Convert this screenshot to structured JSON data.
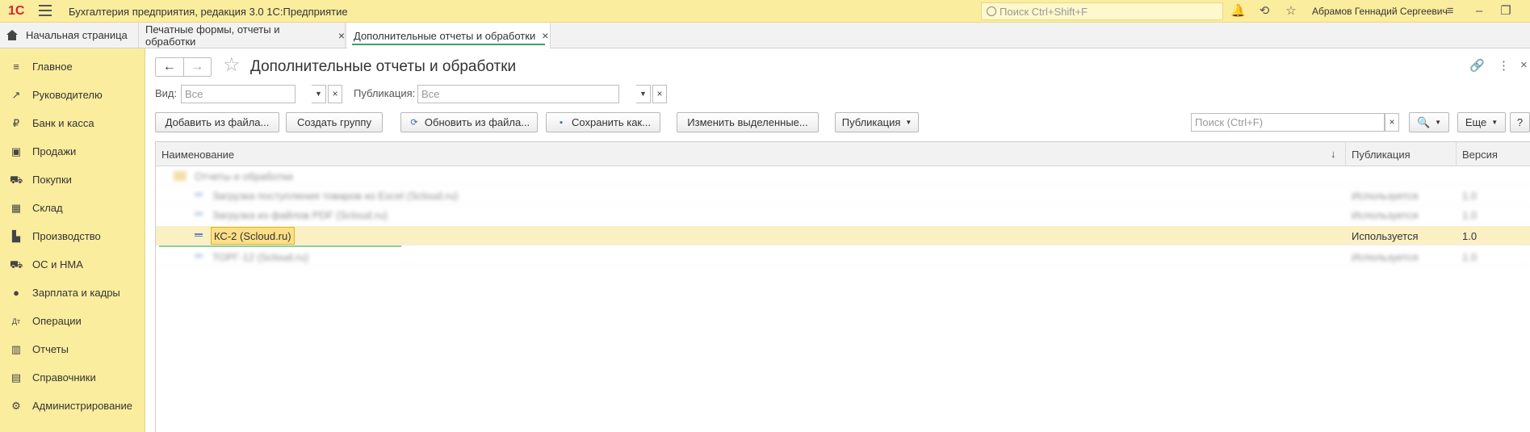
{
  "app": {
    "logo": "1С",
    "title": "Бухгалтерия предприятия, редакция 3.0 1С:Предприятие",
    "search_placeholder": "Поиск Ctrl+Shift+F",
    "user": "Абрамов Геннадий Сергеевич"
  },
  "tabs": {
    "home": "Начальная страница",
    "items": [
      {
        "label": "Печатные формы, отчеты и обработки",
        "close": "×"
      },
      {
        "label": "Дополнительные отчеты и обработки",
        "close": "×"
      }
    ]
  },
  "sidebar": {
    "items": [
      {
        "label": "Главное",
        "icon": "≡"
      },
      {
        "label": "Руководителю",
        "icon": "↗"
      },
      {
        "label": "Банк и касса",
        "icon": "₽"
      },
      {
        "label": "Продажи",
        "icon": "▣"
      },
      {
        "label": "Покупки",
        "icon": "⛟"
      },
      {
        "label": "Склад",
        "icon": "▦"
      },
      {
        "label": "Производство",
        "icon": "▙"
      },
      {
        "label": "ОС и НМА",
        "icon": "⛟"
      },
      {
        "label": "Зарплата и кадры",
        "icon": "●"
      },
      {
        "label": "Операции",
        "icon": "Дт"
      },
      {
        "label": "Отчеты",
        "icon": "▥"
      },
      {
        "label": "Справочники",
        "icon": "▤"
      },
      {
        "label": "Администрирование",
        "icon": "⚙"
      }
    ]
  },
  "form": {
    "title": "Дополнительные отчеты и обработки",
    "back": "←",
    "forward": "→",
    "star": "☆",
    "link_icon": "🔗",
    "more_icon": "⋮",
    "close_icon": "×",
    "filters": {
      "kind_label": "Вид:",
      "kind_placeholder": "Все",
      "publication_label": "Публикация:",
      "publication_placeholder": "Все"
    },
    "buttons": {
      "add_from_file": "Добавить из файла...",
      "create_group": "Создать группу",
      "update_from_file": "Обновить из файла...",
      "save_as": "Сохранить как...",
      "change_selected": "Изменить выделенные...",
      "publication": "Публикация",
      "more": "Еще",
      "help": "?"
    },
    "search_placeholder": "Поиск (Ctrl+F)"
  },
  "table": {
    "columns": [
      "Наименование",
      "Публикация",
      "Версия"
    ],
    "sort_indicator": "↓",
    "blurred_rows": [
      {
        "name": "Отчеты и обработки",
        "publication": "",
        "version": ""
      },
      {
        "name": "Загрузка поступления товаров из Excel (Scloud.ru)",
        "publication": "Используется",
        "version": "1.0"
      },
      {
        "name": "Загрузка из файлов PDF (Scloud.ru)",
        "publication": "Используется",
        "version": "1.0"
      },
      {
        "name": "ТОРГ-12 (Scloud.ru)",
        "publication": "Используется",
        "version": "1.0"
      }
    ],
    "selected_row": {
      "name": "КС-2 (Scloud.ru)",
      "publication": "Используется",
      "version": "1.0"
    }
  }
}
